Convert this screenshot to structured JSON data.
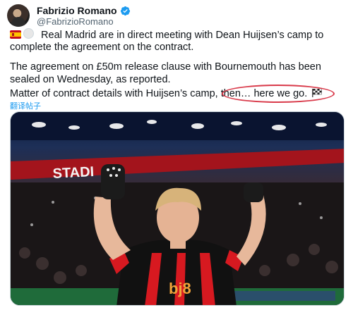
{
  "author": {
    "display_name": "Fabrizio Romano",
    "handle": "@FabrizioRomano",
    "avatar_icon": "user-avatar",
    "verified_icon": "verified-badge-icon",
    "verified_color": "#1d9bf0"
  },
  "tweet": {
    "line1": "Real Madrid are in direct meeting with Dean Huijsen’s camp to",
    "line2": "complete the agreement on the contract.",
    "line3": "The agreement on £50m release clause with Bournemouth has been",
    "line4": "sealed on Wednesday, as reported.",
    "line5": "Matter of contract details with Huijsen’s camp, then… here we go.",
    "emoji_start": [
      "spain-flag-icon",
      "white-circle-icon"
    ],
    "emoji_end": "checkered-flag-icon"
  },
  "translate_link": "翻译帖子",
  "media": {
    "stadium_sign": "STADI",
    "shirt_sponsor": "bj8",
    "accent_red": "#d71920"
  }
}
